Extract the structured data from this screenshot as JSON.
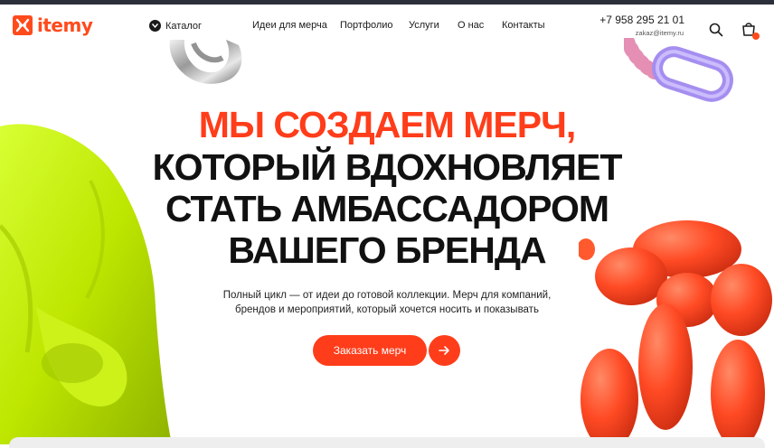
{
  "header": {
    "logo_text": "itemy",
    "catalog_label": "Каталог",
    "nav": [
      {
        "label": "Идеи для мерча"
      },
      {
        "label": "Портфолио"
      },
      {
        "label": "Услуги"
      },
      {
        "label": "О нас"
      },
      {
        "label": "Контакты"
      }
    ],
    "phone": "+7 958 295 21 01",
    "email": "zakaz@itemy.ru",
    "icons": {
      "search": "search-icon",
      "cart": "cart-icon",
      "catalog": "chevron-down-icon"
    }
  },
  "hero": {
    "title_line1": "МЫ СОЗДАЕМ МЕРЧ,",
    "title_line2": "КОТОРЫЙ ВДОХНОВЛЯЕТ",
    "title_line3": "СТАТЬ АМБАССАДОРОМ",
    "title_line4": "ВАШЕГО БРЕНДА",
    "subtitle_line1": "Полный цикл — от идеи до готовой коллекции. Мерч для компаний,",
    "subtitle_line2": "брендов и мероприятий, который хочется носить и показывать",
    "cta_label": "Заказать мерч"
  },
  "colors": {
    "accent": "#ff3d1a",
    "lime": "#c6f000",
    "text": "#111111"
  }
}
